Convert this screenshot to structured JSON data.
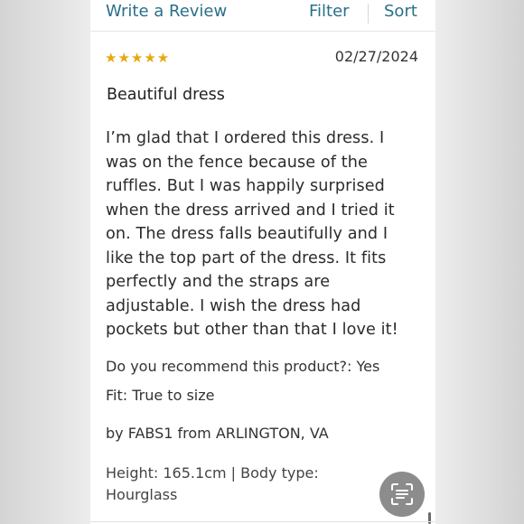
{
  "header": {
    "write_review": "Write a Review",
    "filter": "Filter",
    "sort": "Sort"
  },
  "review": {
    "rating": 5,
    "stars": "★★★★★",
    "date": "02/27/2024",
    "title": "Beautiful dress",
    "body": "I’m glad that I ordered this dress.  I\nwas on the fence because of the\nruffles.  But I was happily surprised\nwhen the dress arrived and I tried it\non.  The dress falls beautifully and I\nlike the top part of the dress.  It fits\nperfectly and the straps are\nadjustable.  I wish the dress had\npockets but other than that I love it!",
    "recommend": "Do you recommend this product?: Yes",
    "fit": "Fit: True to size",
    "byline": "by FABS1 from ARLINGTON, VA",
    "attributes": "Height: 165.1cm   |   Body type: Hourglass"
  },
  "colors": {
    "link": "#2a6f8a",
    "star": "#e7a70f",
    "scan_button": "#8c8c8c"
  },
  "icons": {
    "scan": "text-scan-icon"
  }
}
